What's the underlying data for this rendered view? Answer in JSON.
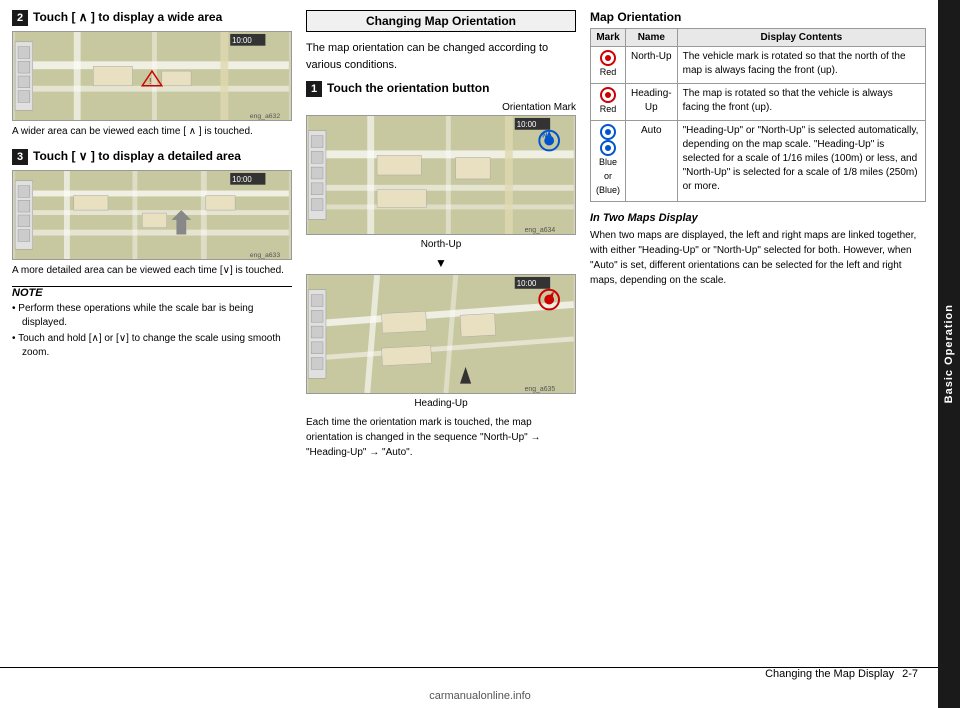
{
  "sidebar": {
    "label": "Basic Operation"
  },
  "left_column": {
    "section2": {
      "badge": "2",
      "title": "Touch [ ∧ ] to display a wide area",
      "image_label": "eng_a632",
      "caption": "A wider area can be viewed each time [ ∧ ] is touched."
    },
    "section3": {
      "badge": "3",
      "title": "Touch [ ∨ ] to display a detailed area",
      "image_label": "eng_a633",
      "caption": "A more detailed area can be viewed each time [∨] is touched."
    },
    "note": {
      "title": "NOTE",
      "items": [
        "Perform these operations while the scale bar is being displayed.",
        "Touch and hold [∧] or [∨] to change the scale using smooth zoom."
      ]
    }
  },
  "middle_column": {
    "section_box": "Changing Map Orientation",
    "intro": "The map orientation can be changed according to various conditions.",
    "step1": {
      "badge": "1",
      "title": "Touch the orientation button",
      "orientation_mark_label": "Orientation Mark",
      "image1_label": "eng_a634",
      "north_up_label": "North-Up",
      "arrow": "▼",
      "image2_label": "eng_a635",
      "heading_up_label": "Heading-Up",
      "sequence_text": "Each time the orientation mark is touched, the map orientation is changed in the sequence \"North-Up\" → \"Heading-Up\" → \"Auto\"."
    }
  },
  "right_column": {
    "map_orientation_title": "Map Orientation",
    "table": {
      "headers": [
        "Mark",
        "Name",
        "Display Contents"
      ],
      "rows": [
        {
          "mark_color": "Red",
          "mark_type": "red",
          "name": "North-Up",
          "display": "The vehicle mark is rotated so that the north of the map is always facing the front (up)."
        },
        {
          "mark_color": "Red",
          "mark_type": "red",
          "name": "Heading-\nUp",
          "display": "The map is rotated so that the vehicle is always facing the front (up)."
        },
        {
          "mark_color": "Blue\nor\n(Blue)",
          "mark_type": "blue",
          "name": "Auto",
          "display": "\"Heading-Up\" or \"North-Up\" is selected automatically, depending on the map scale. \"Heading-Up\" is selected for a scale of 1/16 miles (100m) or less, and \"North-Up\" is selected for a scale of 1/8 miles (250m) or more."
        }
      ]
    },
    "in_two_maps": {
      "title": "In Two Maps Display",
      "text": "When two maps are displayed, the left and right maps are linked together, with either \"Heading-Up\" or \"North-Up\" selected for both. However, when \"Auto\" is set, different orientations can be selected for the left and right maps, depending on the scale."
    }
  },
  "footer": {
    "text": "Changing the Map Display",
    "page": "2-7"
  },
  "watermark": "carmanualonline.info"
}
